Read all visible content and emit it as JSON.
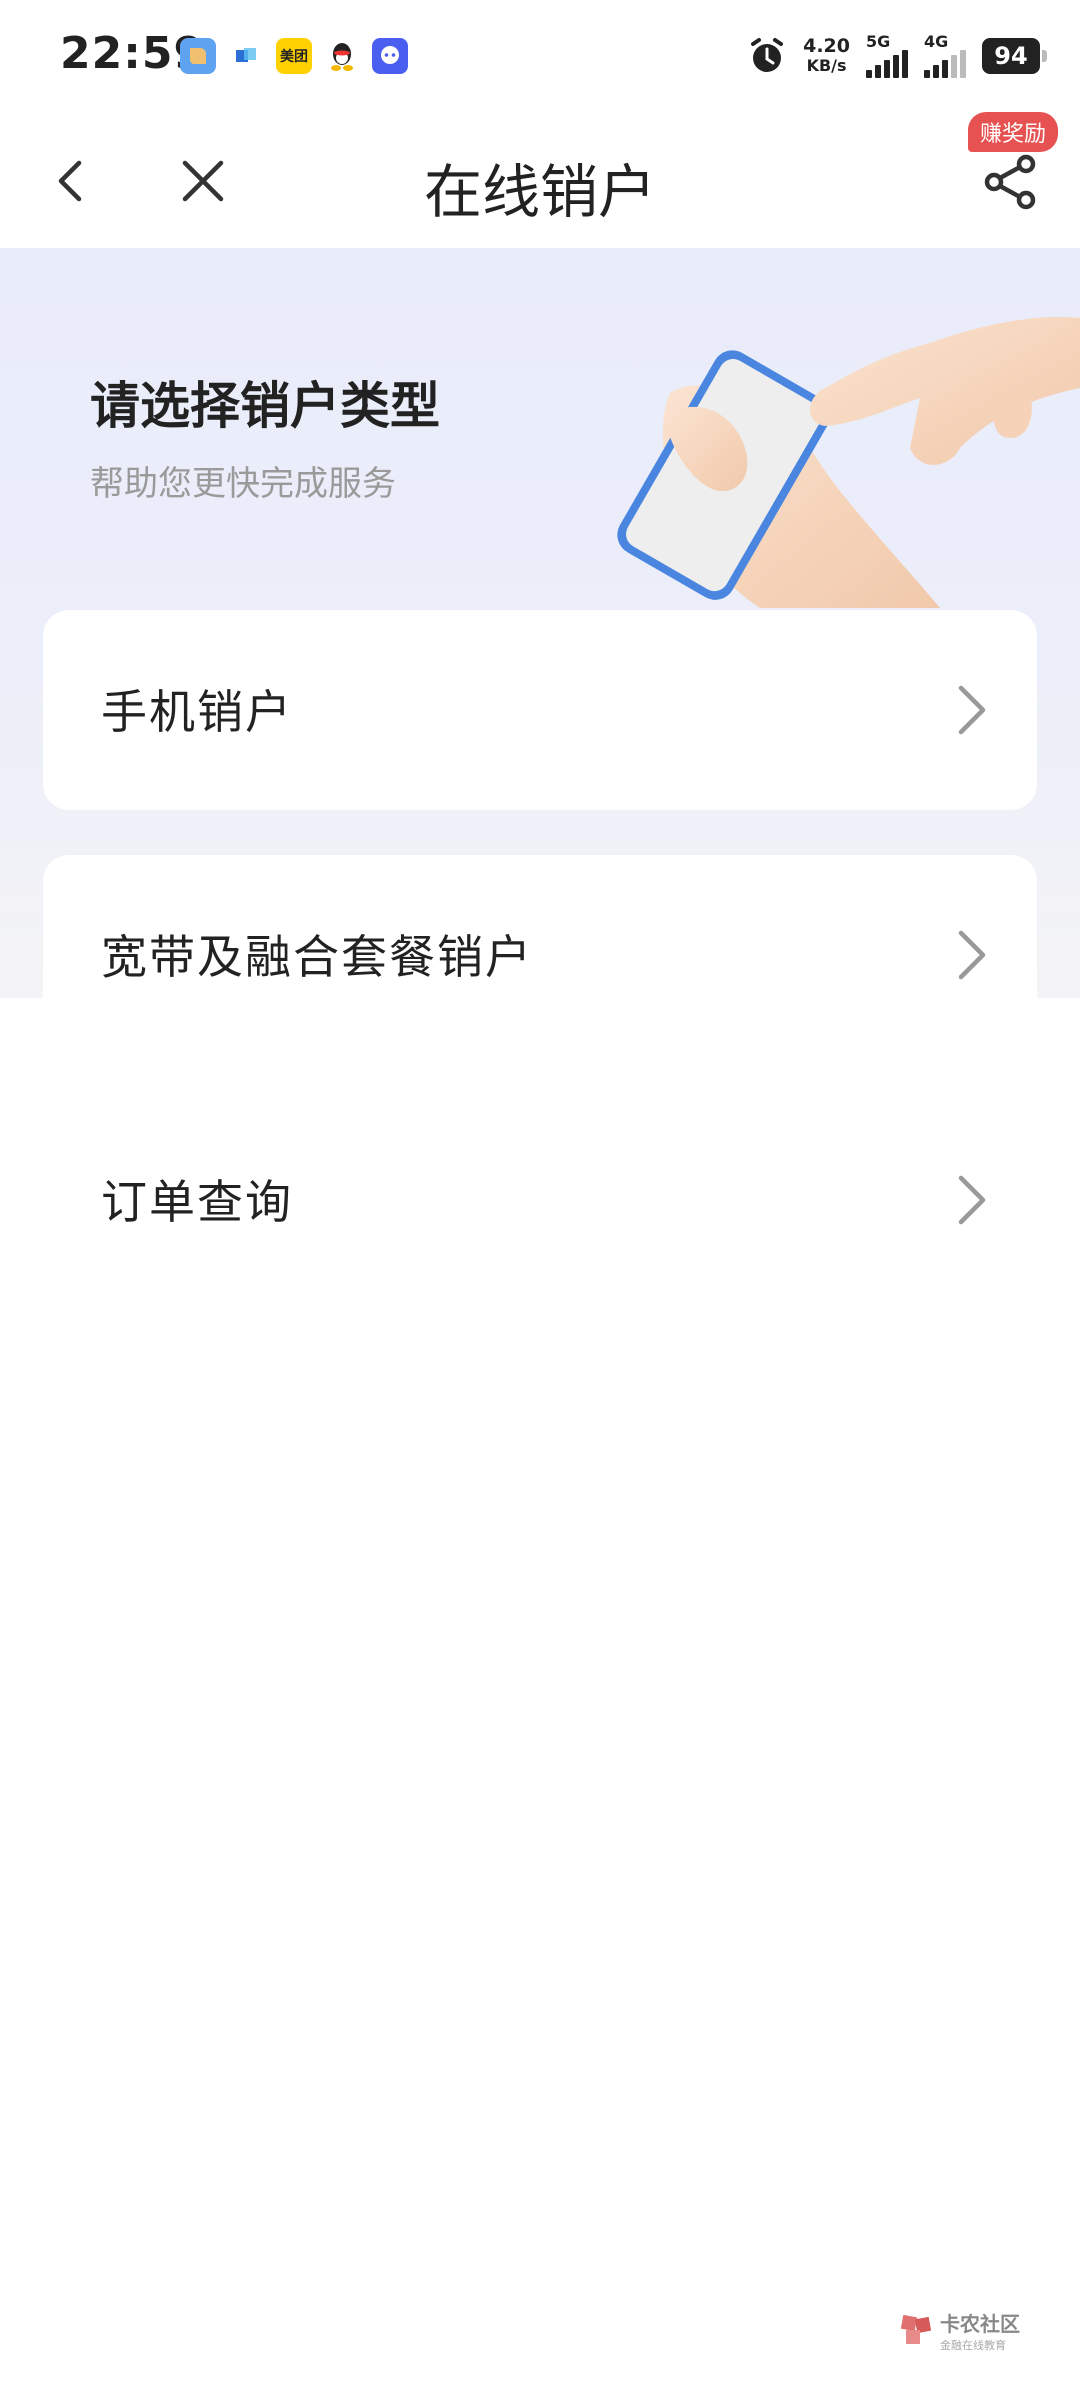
{
  "status_bar": {
    "time": "22:59",
    "app_icons": [
      "app-blue-icon",
      "app-cube-icon",
      "meituan-icon",
      "qq-icon",
      "chat-app-icon"
    ],
    "meituan_label": "美团",
    "speed_value": "4.20",
    "speed_unit": "KB/s",
    "sim1_label": "5G",
    "sim2_label": "4G",
    "battery": "94"
  },
  "nav": {
    "title": "在线销户",
    "reward_badge": "赚奖励"
  },
  "hero": {
    "title": "请选择销户类型",
    "subtitle": "帮助您更快完成服务"
  },
  "menu": {
    "items": [
      {
        "label": "手机销户"
      },
      {
        "label": "宽带及融合套餐销户"
      },
      {
        "label": "订单查询"
      }
    ]
  },
  "watermark": {
    "line1": "卡农社区",
    "line2": "金融在线教育"
  },
  "colors": {
    "accent_red": "#e65252",
    "hero_bg": "#e9ecfb",
    "phone_blue": "#4a86e0"
  }
}
